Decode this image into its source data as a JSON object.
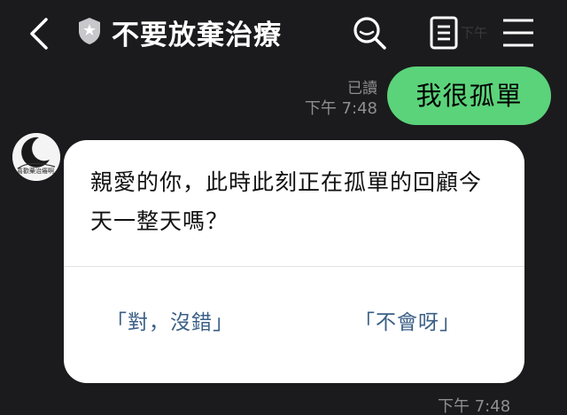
{
  "header": {
    "title": "不要放棄治療",
    "back_icon": "chevron-left-icon",
    "badge_icon": "shield-icon",
    "ghost_text": "下午"
  },
  "messages": {
    "sent": {
      "text": "我很孤單",
      "read_label": "已讀",
      "time": "下午 7:48",
      "bubble_color": "#5bd37a"
    },
    "card": {
      "avatar_text": "喜歡藥治癢啊",
      "body": "親愛的你，此時此刻正在孤單的回顧今天一整天嗎？",
      "reply_yes": "「對，沒錯」",
      "reply_no": "「不會呀」",
      "time": "下午 7:48",
      "reply_color": "#3b5f86"
    }
  }
}
